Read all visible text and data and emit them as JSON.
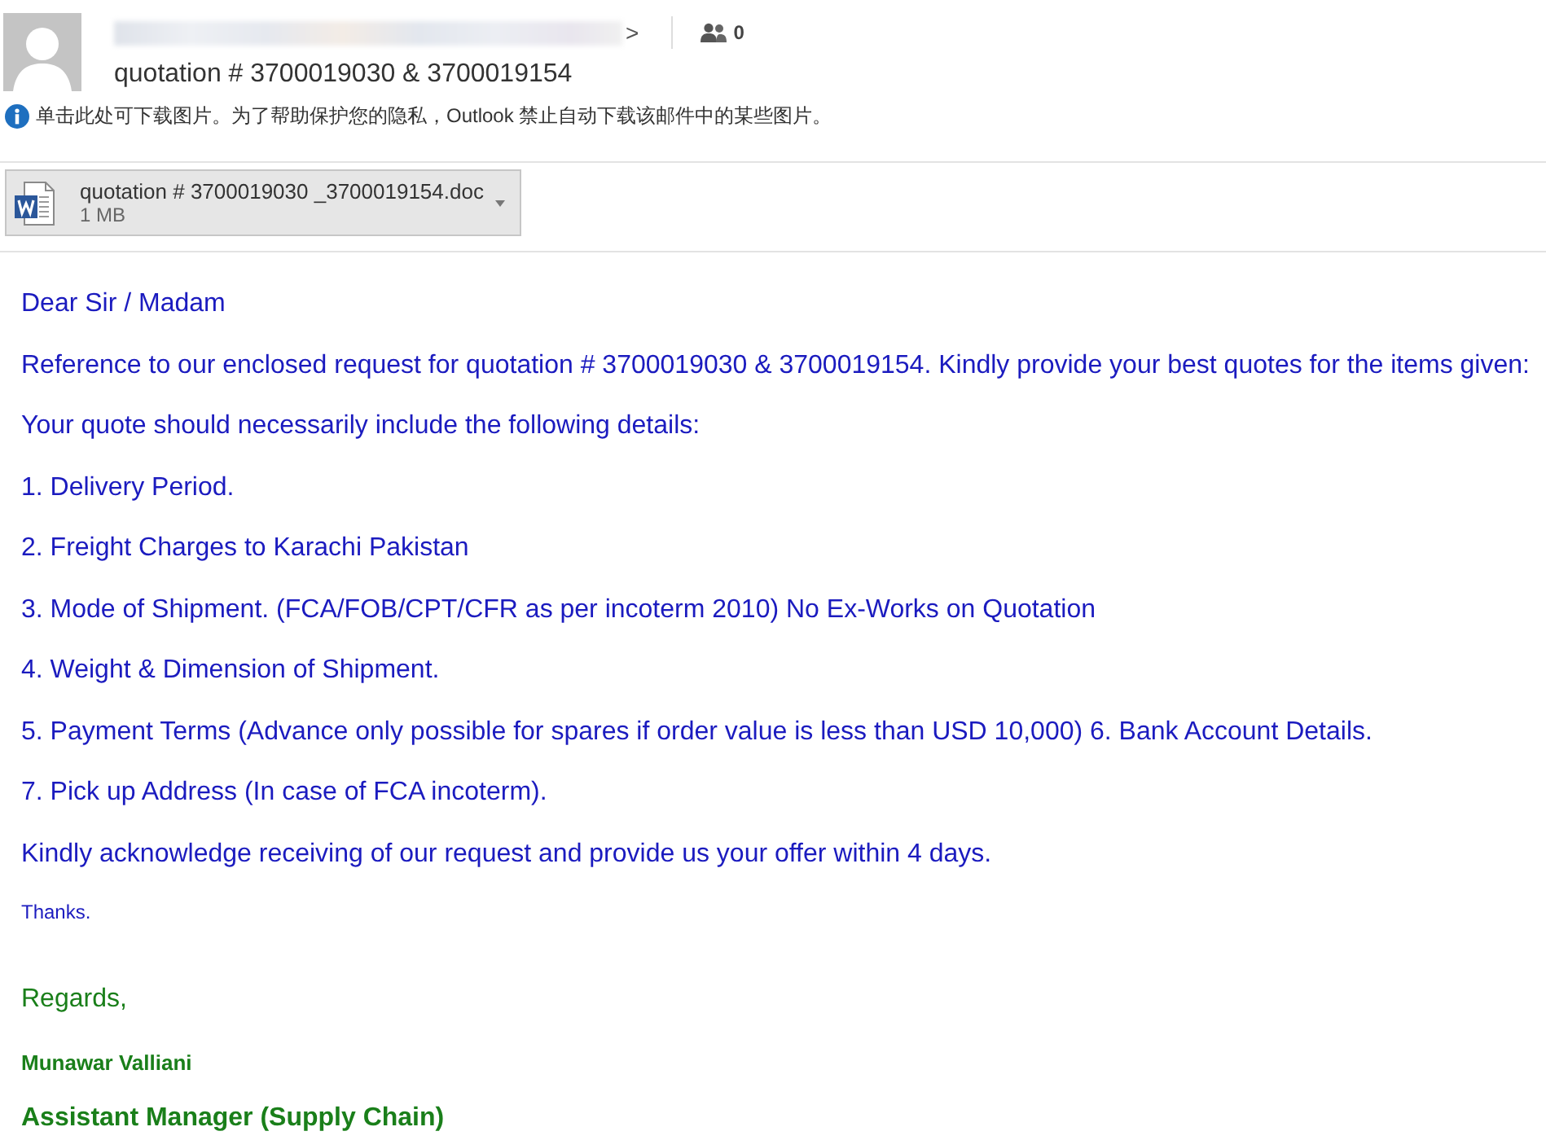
{
  "header": {
    "sender": {
      "redacted": true,
      "tail": ">"
    },
    "people_count": "0",
    "subject": "quotation # 3700019030 & 3700019154",
    "info_bar": "单击此处可下载图片。为了帮助保护您的隐私，Outlook 禁止自动下载该邮件中的某些图片。"
  },
  "attachments": [
    {
      "name": "quotation # 3700019030 _3700019154.doc",
      "size": "1 MB"
    }
  ],
  "body": [
    {
      "kind": "text",
      "text": "Dear Sir / Madam"
    },
    {
      "kind": "text",
      "text": "Reference to our enclosed request for quotation # 3700019030 & 3700019154. Kindly provide your best quotes for the items given:"
    },
    {
      "kind": "text",
      "text": "Your quote should necessarily include the following details:"
    },
    {
      "kind": "text",
      "text": "1. Delivery Period."
    },
    {
      "kind": "text",
      "text": "2. Freight Charges to Karachi Pakistan"
    },
    {
      "kind": "text",
      "text": "3. Mode of Shipment. (FCA/FOB/CPT/CFR as per incoterm 2010) No Ex-Works on Quotation"
    },
    {
      "kind": "text",
      "text": "4. Weight & Dimension of Shipment."
    },
    {
      "kind": "text",
      "text": "5. Payment Terms (Advance only possible for spares if order value is less than USD 10,000) 6. Bank Account Details."
    },
    {
      "kind": "text",
      "text": "7. Pick up Address (In case of FCA incoterm)."
    },
    {
      "kind": "text",
      "text": "Kindly acknowledge receiving of our request and provide us your offer within 4 days."
    },
    {
      "kind": "small",
      "text": "Thanks."
    },
    {
      "kind": "closing",
      "text": "Regards,"
    },
    {
      "kind": "name",
      "text": "Munawar Valliani"
    },
    {
      "kind": "title",
      "text": "Assistant Manager (Supply Chain)"
    }
  ]
}
